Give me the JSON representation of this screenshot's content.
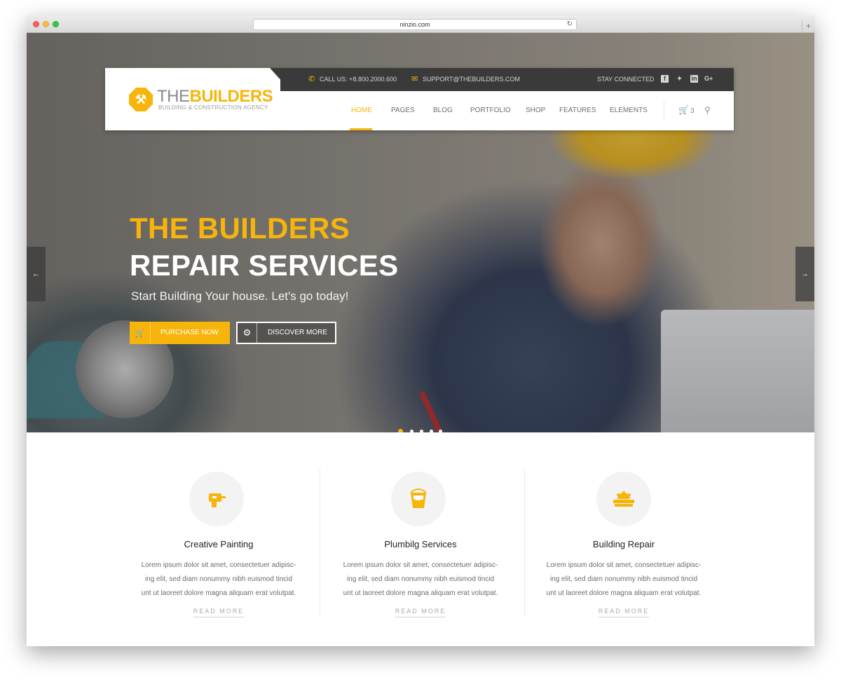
{
  "browser": {
    "url": "ninzio.com",
    "reload_icon": "reload-icon",
    "new_tab": "+"
  },
  "topbar": {
    "call": "CALL US: +8.800.2000.600",
    "email": "SUPPORT@THEBUILDERS.COM",
    "stay_connected": "STAY CONNECTED",
    "social": [
      "facebook-icon",
      "twitter-icon",
      "linkedin-icon",
      "google-plus-icon"
    ]
  },
  "logo": {
    "the": "THE",
    "builders": "BUILDERS",
    "tagline": "BUILDING & CONSTRUCTION AGENCY"
  },
  "nav": {
    "items": [
      "HOME",
      "PAGES",
      "BLOG",
      "PORTFOLIO",
      "SHOP",
      "FEATURES",
      "ELEMENTS"
    ],
    "active": "HOME",
    "cart_count": "3"
  },
  "hero": {
    "line1": "THE BUILDERS",
    "line2": "REPAIR SERVICES",
    "subtitle": "Start Building Your house. Let's go today!",
    "purchase_label": "PURCHASE NOW",
    "discover_label": "DISCOVER MORE",
    "slides": 5,
    "active_slide": 1
  },
  "features": [
    {
      "title": "Creative Painting",
      "icon": "drill-icon",
      "desc": "Lorem ipsum dolor sit amet, consectetuer adipisc-ing elit, sed diam nonummy nibh euismod tincid unt ut laoreet dolore magna aliquam erat volutpat.",
      "more": "READ MORE"
    },
    {
      "title": "Plumbilg Services",
      "icon": "paint-bucket-icon",
      "desc": "Lorem ipsum dolor sit amet, consectetuer adipisc-ing elit, sed diam nonummy nibh euismod tincid unt ut laoreet dolore magna aliquam erat volutpat.",
      "more": "READ MORE"
    },
    {
      "title": "Building Repair",
      "icon": "saw-blade-icon",
      "desc": "Lorem ipsum dolor sit amet, consectetuer adipisc-ing elit, sed diam nonummy nibh euismod tincid unt ut laoreet dolore magna aliquam erat volutpat.",
      "more": "READ MORE"
    }
  ],
  "colors": {
    "accent": "#f7b50c",
    "topbar": "#3a3a3a",
    "text": "#222222"
  }
}
